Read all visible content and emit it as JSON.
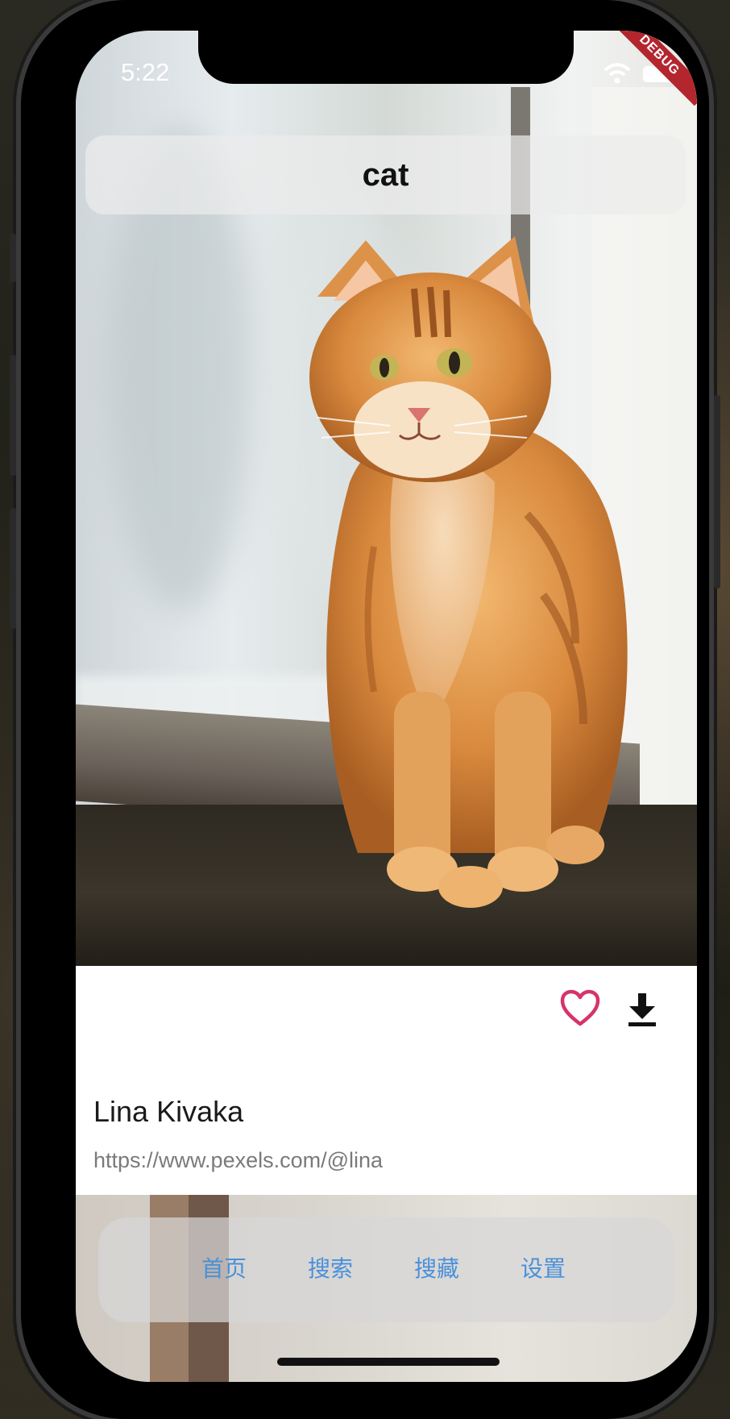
{
  "status_bar": {
    "time": "5:22",
    "debug_label": "DEBUG"
  },
  "header": {
    "title": "cat"
  },
  "photo": {
    "subject": "orange tabby cat sitting on windowsill"
  },
  "actions": {
    "like_icon": "heart-outline-icon",
    "download_icon": "download-icon",
    "like_color": "#d6336c"
  },
  "author": {
    "name": "Lina Kivaka",
    "url": "https://www.pexels.com/@lina"
  },
  "nav": {
    "items": [
      {
        "label": "首页"
      },
      {
        "label": "搜索"
      },
      {
        "label": "搜藏"
      },
      {
        "label": "设置"
      }
    ],
    "accent": "#4a90d9"
  }
}
